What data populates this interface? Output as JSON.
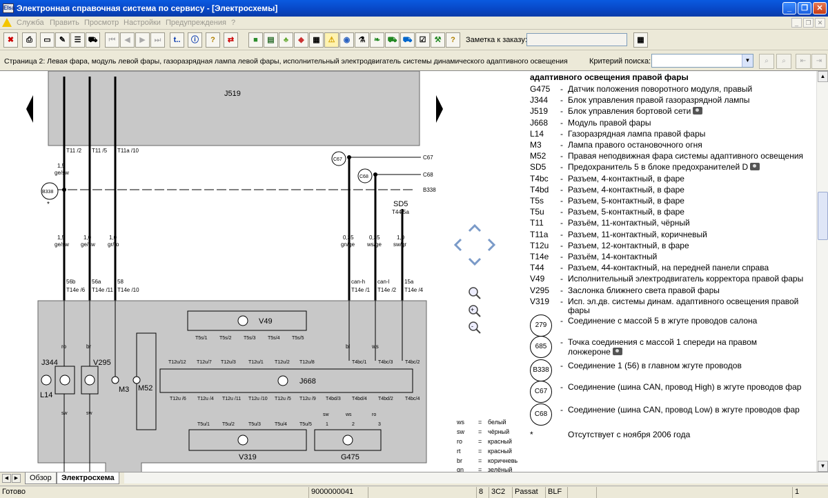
{
  "window": {
    "title": "Электронная справочная система по сервису - [Электросхемы]",
    "app_icon_text": "Elsa"
  },
  "menu": [
    "Служба",
    "Править",
    "Просмотр",
    "Настройки",
    "Предупреждения",
    "?"
  ],
  "toolbar": {
    "buttons_left": [
      "printer-button",
      "print-preview-button",
      "new-document-button",
      "notes-button",
      "edit-button",
      "car-button"
    ],
    "nav_buttons": [
      "first-page-button",
      "prev-page-button",
      "next-page-button",
      "last-page-button"
    ],
    "t_label": "t..",
    "note_label": "Заметка к заказу:",
    "note_value": ""
  },
  "pagebar": {
    "page_title": "Страница 2: Левая фара, модуль левой фары, газоразрядная лампа левой фары, исполнительный электродвигатель системы динамического адаптивного освещения",
    "criteria_label": "Критерий поиска:",
    "criteria_value": ""
  },
  "diagram": {
    "top_block": "J519",
    "labels": {
      "j668": "J668",
      "v49": "V49",
      "v319": "V319",
      "g475": "G475",
      "sd5": "SD5",
      "t445a": "T44/5a",
      "j344": "J344",
      "v295": "V295",
      "l14": "L14",
      "m3": "M3",
      "m52": "M52",
      "c67": "C67",
      "c68": "C68",
      "b338": "B338",
      "star": "*"
    },
    "wires": [
      {
        "top": "T11 /2",
        "size": "1,5",
        "color": "ge/sw",
        "bottom_pin": "56b",
        "connector": "T14e /6"
      },
      {
        "top": "T11 /5",
        "size": "1,0",
        "color": "ge/sw",
        "bottom_pin": "56a",
        "connector": "T14e /11"
      },
      {
        "top": "T11a /10",
        "size": "1,0",
        "color": "gr/ro",
        "bottom_pin": "58",
        "connector": "T14e /10"
      },
      {
        "top": "C67",
        "size": "0,35",
        "color": "gn/ge",
        "bottom_pin": "can-h",
        "connector": "T14e /1"
      },
      {
        "top": "C68",
        "size": "0,35",
        "color": "ws/ge",
        "bottom_pin": "can-l",
        "connector": "T14e /2"
      },
      {
        "top": "SD5",
        "size": "1,0",
        "color": "sw/gr",
        "bottom_pin": "15a",
        "connector": "T14e /4"
      }
    ],
    "wire_colors_top": [
      "1,5 ge/sw"
    ],
    "sub_labels": {
      "ro": "ro",
      "br": "br",
      "bl": "bl",
      "ws": "ws",
      "sw": "sw"
    },
    "v49_pins": [
      "T5s/1",
      "T5s/2",
      "T5s/3",
      "T5s/4",
      "T5s/5"
    ],
    "j668_top_pins": [
      "T12u/12",
      "T12u/7",
      "T12u/3",
      "T12u/1",
      "T12u/2",
      "T12u/8"
    ],
    "j668_top_right": [
      "T4bc/1",
      "T4bc/3",
      "T4bc/2"
    ],
    "j668_bottom_pins": [
      "T12u /6",
      "T12u /4",
      "T12u /11",
      "T12u /10",
      "T12u /5",
      "T12u /9"
    ],
    "j668_bottom_right": [
      "T4bd/3",
      "T4bd/4",
      "T4bd/2",
      "T4bc/4"
    ],
    "v319_pins": [
      "T5u/1",
      "T5u/2",
      "T5u/3",
      "T5u/4",
      "T5u/5"
    ],
    "g475_pins": [
      "1",
      "2",
      "3"
    ],
    "color_key": [
      {
        "code": "ws",
        "name": "белый"
      },
      {
        "code": "sw",
        "name": "чёрный"
      },
      {
        "code": "ro",
        "name": "красный"
      },
      {
        "code": "rt",
        "name": "красный"
      },
      {
        "code": "br",
        "name": "коричневый"
      },
      {
        "code": "gn",
        "name": "зелёный"
      }
    ]
  },
  "legend": {
    "heading": "адаптивного освещения правой фары",
    "items": [
      {
        "code": "G475",
        "desc": "Датчик положения поворотного модуля, правый",
        "camera": false
      },
      {
        "code": "J344",
        "desc": "Блок управления правой газоразрядной лампы",
        "camera": false
      },
      {
        "code": "J519",
        "desc": "Блок управления бортовой сети",
        "camera": true
      },
      {
        "code": "J668",
        "desc": "Модуль правой фары",
        "camera": false
      },
      {
        "code": "L14",
        "desc": "Газоразрядная лампа правой фары",
        "camera": false
      },
      {
        "code": "M3",
        "desc": "Лампа правого остановочного огня",
        "camera": false
      },
      {
        "code": "M52",
        "desc": "Правая неподвижная фара системы адаптивного освещения",
        "camera": false
      },
      {
        "code": "SD5",
        "desc": "Предохранитель 5 в блоке предохранителей D",
        "camera": true
      },
      {
        "code": "T4bc",
        "desc": "Разъем, 4-контактный, в фаре",
        "camera": false
      },
      {
        "code": "T4bd",
        "desc": "Разъем, 4-контактный, в фаре",
        "camera": false
      },
      {
        "code": "T5s",
        "desc": "Разъем, 5-контактный, в фаре",
        "camera": false
      },
      {
        "code": "T5u",
        "desc": "Разъем, 5-контактный, в фаре",
        "camera": false
      },
      {
        "code": "T11",
        "desc": "Разъём, 11-контактный, чёрный",
        "camera": false
      },
      {
        "code": "T11a",
        "desc": "Разъем, 11-контактный, коричневый",
        "camera": false
      },
      {
        "code": "T12u",
        "desc": "Разъем, 12-контактный, в фаре",
        "camera": false
      },
      {
        "code": "T14e",
        "desc": "Разъём, 14-контактный",
        "camera": false
      },
      {
        "code": "T44",
        "desc": "Разъем, 44-контактный, на передней панели справа",
        "camera": false
      },
      {
        "code": "V49",
        "desc": "Исполнительный электродвигатель корректора правой фары",
        "camera": false
      },
      {
        "code": "V295",
        "desc": "Заслонка ближнего света правой фары",
        "camera": false
      },
      {
        "code": "V319",
        "desc": "Исп. эл.дв. системы динам. адаптивного освещения правой",
        "camera": false
      }
    ],
    "v319_cont": "фары",
    "symbols": [
      {
        "code": "279",
        "desc": "Соединение с массой 5 в жгуте проводов салона",
        "desc2": ""
      },
      {
        "code": "685",
        "desc": "Точка соединения с массой 1 спереди на правом",
        "desc2": "лонжероне"
      },
      {
        "code": "B338",
        "desc": "Соединение 1 (56) в главном жгуте проводов",
        "desc2": ""
      },
      {
        "code": "C67",
        "desc": "Соединение (шина CAN, провод High) в жгуте проводов фар",
        "desc2": ""
      },
      {
        "code": "C68",
        "desc": "Соединение (шина CAN, провод Low) в жгуте проводов фар",
        "desc2": ""
      }
    ],
    "star_code": "*",
    "star_desc": "Отсутствует с ноября 2006 года"
  },
  "tabs": [
    "Обзор",
    "Электросхема"
  ],
  "status": {
    "text": "Готово",
    "vin": "9000000041",
    "p1": "8",
    "p2": "3C2",
    "p3": "Passat",
    "p4": "BLF",
    "p5": "1"
  },
  "colors": {
    "titlebar": "#0a4fd6",
    "face": "#ece9d8",
    "diagram_fill": "#c8c8c8"
  }
}
